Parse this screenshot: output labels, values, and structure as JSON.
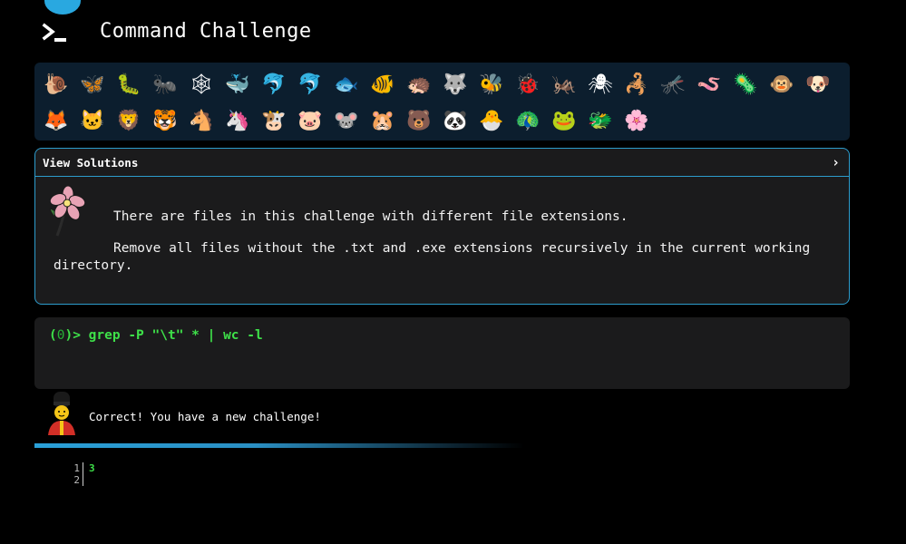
{
  "header": {
    "title": "Command Challenge",
    "logo_icon": "terminal-prompt-icon"
  },
  "emojis": {
    "row1": [
      "🐌",
      "🦋",
      "🐛",
      "🐜",
      "🕸",
      "🐳",
      "🐬",
      "🐬",
      "🐟",
      "🐠",
      "🦔",
      "🐺",
      "🐝",
      "🐞",
      "🦗",
      "🕷",
      "🦂",
      "🦟",
      "🪱",
      "🦠",
      "🐵",
      "🐶"
    ],
    "row2": [
      "🦊",
      "🐱",
      "🦁",
      "🐯",
      "🐴",
      "🦄",
      "🐮",
      "🐷",
      "🐭",
      "🐹",
      "🐻",
      "🐼",
      "🐣",
      "🦚",
      "🐸",
      "🐲",
      "🌸"
    ]
  },
  "solutions": {
    "label": "View Solutions",
    "chevron": "›",
    "challenge_line1": "There are files in this challenge with different file extensions.",
    "challenge_line2": "Remove all files without the .txt and .exe extensions recursively in the current working directory."
  },
  "terminal": {
    "prompt_open": "(",
    "exit_code": "0",
    "prompt_close": ")> ",
    "command": "grep -P \"\\t\" * | wc -l"
  },
  "status": {
    "message": "Correct! You have a new challenge!"
  },
  "output": {
    "line_numbers": [
      "1",
      "2"
    ],
    "lines": [
      "3",
      ""
    ]
  },
  "colors": {
    "accent": "#2d9ccc",
    "terminal_green": "#3ee049",
    "panel_bg": "#1b1b1c",
    "emoji_panel_bg": "#0c1e2e"
  }
}
